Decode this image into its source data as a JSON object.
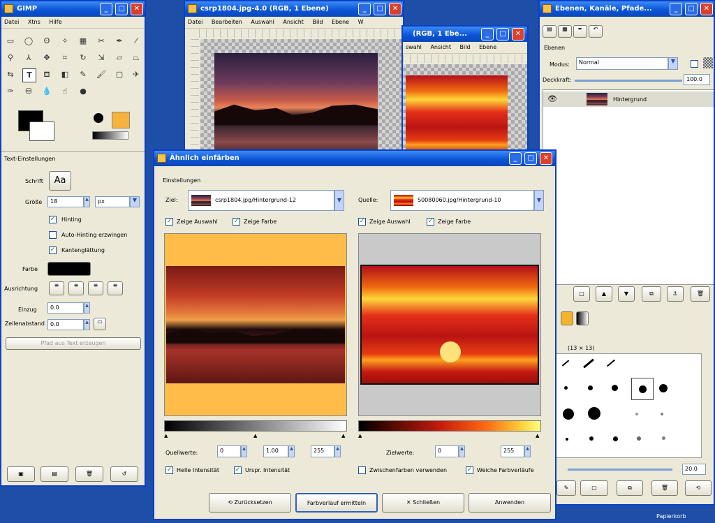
{
  "toolbox": {
    "title": "GIMP",
    "menu": [
      "Datei",
      "Xtns",
      "Hilfe"
    ],
    "options_title": "Text-Einstellungen",
    "font_label": "Schrift",
    "font_value": "Aa",
    "size_label": "Größe",
    "size_value": "18",
    "size_unit": "px",
    "hinting_label": "Hinting",
    "autohint_label": "Auto-Hinting erzwingen",
    "antialias_label": "Kantenglättung",
    "color_label": "Farbe",
    "justify_label": "Ausrichtung",
    "indent_label": "Einzug",
    "indent_value": "0.0",
    "line_spacing_label": "Zeilenabstand",
    "line_spacing_value": "0.0",
    "path_button": "Pfad aus Text erzeugen"
  },
  "image1": {
    "title": "csrp1804.jpg-4.0 (RGB, 1 Ebene)",
    "menu": [
      "Datei",
      "Bearbeiten",
      "Auswahl",
      "Ansicht",
      "Bild",
      "Ebene",
      "W"
    ]
  },
  "image2": {
    "title": "(RGB, 1 Ebe...",
    "menu": [
      "swahl",
      "Ansicht",
      "Bild",
      "Ebene"
    ]
  },
  "layers": {
    "title": "Ebenen, Kanäle, Pfade...",
    "panel_label": "Ebenen",
    "mode_label": "Modus:",
    "mode_value": "Normal",
    "opacity_label": "Deckkraft:",
    "opacity_value": "100.0",
    "layer_name": "Hintergrund",
    "brush_info": "(13 × 13)",
    "brush_spacing": "20.0",
    "status": "Papierkorb"
  },
  "dialog": {
    "title": "Ähnlich einfärben",
    "section": "Einstellungen",
    "dest_label": "Ziel:",
    "dest_value": "csrp1804.jpg/Hintergrund-12",
    "source_label": "Quelle:",
    "source_value": "S0080060.jpg/Hintergrund-10",
    "show_selection": "Zeige Auswahl",
    "show_color": "Zeige Farbe",
    "source_range_label": "Quellwerte:",
    "dest_range_label": "Zielwerte:",
    "range_min": "0",
    "range_gamma": "1.00",
    "range_max": "255",
    "dest_min": "0",
    "dest_max": "255",
    "keep_intensity": "Helle Intensität",
    "orig_intensity": "Urspr. Intensität",
    "use_subcolors": "Zwischenfarben verwenden",
    "smooth_palette": "Weiche Farbverläufe",
    "buttons": {
      "reset": "Zurücksetzen",
      "get_palette": "Farbverlauf ermitteln",
      "close": "Schließen",
      "apply": "Anwenden"
    }
  }
}
